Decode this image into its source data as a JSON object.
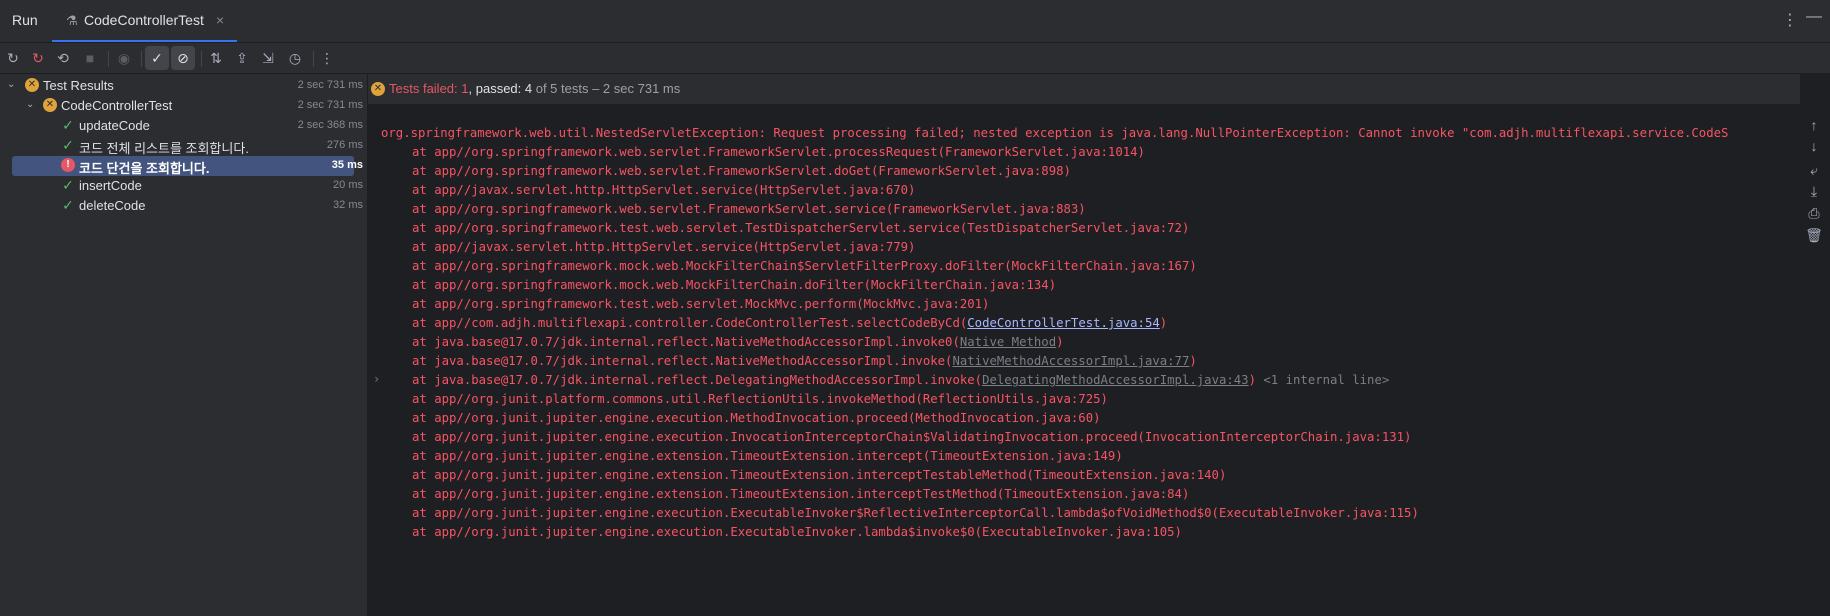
{
  "tool_window": {
    "title": "Run",
    "tab": {
      "title": "CodeControllerTest",
      "close": "×"
    },
    "more_actions_icon": "⋮",
    "minimize_icon": "—"
  },
  "toolbar": {
    "buttons": [
      {
        "name": "rerun-icon",
        "glyph": "↻"
      },
      {
        "name": "rerun-failed-icon",
        "glyph": "↻"
      },
      {
        "name": "toggle-auto-test-icon",
        "glyph": "⟲"
      },
      {
        "name": "stop-icon",
        "glyph": "■"
      },
      {
        "name": "show-ignored-icon",
        "glyph": "◉"
      },
      {
        "name": "show-passed-icon",
        "glyph": "✓"
      },
      {
        "name": "show-ignored-tests-icon",
        "glyph": "⊘"
      },
      {
        "name": "sort-icon",
        "glyph": "⇅"
      },
      {
        "name": "import-tests-icon",
        "glyph": "⇪"
      },
      {
        "name": "export-tests-icon",
        "glyph": "⇲"
      },
      {
        "name": "history-icon",
        "glyph": "◷"
      },
      {
        "name": "more-icon",
        "glyph": "⋮"
      }
    ]
  },
  "tree": {
    "root": {
      "label": "Test Results",
      "time": "2 sec 731 ms",
      "status": "warn"
    },
    "class": {
      "label": "CodeControllerTest",
      "time": "2 sec 731 ms",
      "status": "warn"
    },
    "tests": [
      {
        "label": "updateCode",
        "time": "2 sec 368 ms",
        "status": "pass"
      },
      {
        "label": "코드 전체 리스트를 조회합니다.",
        "time": "276 ms",
        "status": "pass"
      },
      {
        "label": "코드 단건을 조회합니다.",
        "time": "35 ms",
        "status": "fail",
        "selected": true
      },
      {
        "label": "insertCode",
        "time": "20 ms",
        "status": "pass"
      },
      {
        "label": "deleteCode",
        "time": "32 ms",
        "status": "pass"
      }
    ]
  },
  "status": {
    "failed_label": "Tests failed: 1",
    "sep": ", ",
    "passed_label": "passed: 4",
    "of_label": " of 5 tests – 2 sec 731 ms"
  },
  "console": {
    "first_line": "org.springframework.web.util.NestedServletException: Request processing failed; nested exception is java.lang.NullPointerException: Cannot invoke \"com.adjh.multiflexapi.service.CodeS",
    "frames": [
      {
        "text": "at app//org.springframework.web.servlet.FrameworkServlet.processRequest(FrameworkServlet.java:1014)"
      },
      {
        "text": "at app//org.springframework.web.servlet.FrameworkServlet.doGet(FrameworkServlet.java:898)"
      },
      {
        "text": "at app//javax.servlet.http.HttpServlet.service(HttpServlet.java:670)"
      },
      {
        "text": "at app//org.springframework.web.servlet.FrameworkServlet.service(FrameworkServlet.java:883)"
      },
      {
        "text": "at app//org.springframework.test.web.servlet.TestDispatcherServlet.service(TestDispatcherServlet.java:72)"
      },
      {
        "text": "at app//javax.servlet.http.HttpServlet.service(HttpServlet.java:779)"
      },
      {
        "text": "at app//org.springframework.mock.web.MockFilterChain$ServletFilterProxy.doFilter(MockFilterChain.java:167)"
      },
      {
        "text": "at app//org.springframework.mock.web.MockFilterChain.doFilter(MockFilterChain.java:134)"
      },
      {
        "text": "at app//org.springframework.test.web.servlet.MockMvc.perform(MockMvc.java:201)"
      },
      {
        "text": "at app//com.adjh.multiflexapi.controller.CodeControllerTest.selectCodeByCd(",
        "link": "CodeControllerTest.java:54",
        "after": ")"
      },
      {
        "text": "at java.base@17.0.7/jdk.internal.reflect.NativeMethodAccessorImpl.invoke0(",
        "gray_link": "Native Method",
        "after": ")"
      },
      {
        "text": "at java.base@17.0.7/jdk.internal.reflect.NativeMethodAccessorImpl.invoke(",
        "gray_link": "NativeMethodAccessorImpl.java:77",
        "after": ")"
      },
      {
        "text": "at java.base@17.0.7/jdk.internal.reflect.DelegatingMethodAccessorImpl.invoke(",
        "gray_link": "DelegatingMethodAccessorImpl.java:43",
        "after": ")",
        "internal": " <1 internal line>",
        "fold": "›"
      },
      {
        "text": "at app//org.junit.platform.commons.util.ReflectionUtils.invokeMethod(ReflectionUtils.java:725)"
      },
      {
        "text": "at app//org.junit.jupiter.engine.execution.MethodInvocation.proceed(MethodInvocation.java:60)"
      },
      {
        "text": "at app//org.junit.jupiter.engine.execution.InvocationInterceptorChain$ValidatingInvocation.proceed(InvocationInterceptorChain.java:131)"
      },
      {
        "text": "at app//org.junit.jupiter.engine.extension.TimeoutExtension.intercept(TimeoutExtension.java:149)"
      },
      {
        "text": "at app//org.junit.jupiter.engine.extension.TimeoutExtension.interceptTestableMethod(TimeoutExtension.java:140)"
      },
      {
        "text": "at app//org.junit.jupiter.engine.extension.TimeoutExtension.interceptTestMethod(TimeoutExtension.java:84)"
      },
      {
        "text": "at app//org.junit.jupiter.engine.execution.ExecutableInvoker$ReflectiveInterceptorCall.lambda$ofVoidMethod$0(ExecutableInvoker.java:115)"
      },
      {
        "text": "at app//org.junit.jupiter.engine.execution.ExecutableInvoker.lambda$invoke$0(ExecutableInvoker.java:105)"
      }
    ]
  },
  "side_actions": [
    {
      "name": "up-stack-icon",
      "glyph": "↑"
    },
    {
      "name": "down-stack-icon",
      "glyph": "↓"
    },
    {
      "name": "soft-wrap-icon",
      "glyph": "⤶"
    },
    {
      "name": "scroll-to-end-icon",
      "glyph": "⤓"
    },
    {
      "name": "print-icon",
      "glyph": "⎙"
    },
    {
      "name": "clear-icon",
      "glyph": "🗑"
    }
  ],
  "colors": {
    "error_text": "#f75464",
    "selected_row": "#43557f",
    "pass_check": "#5fb865",
    "warn_icon": "#e0a33c",
    "fail_icon": "#e55765"
  }
}
